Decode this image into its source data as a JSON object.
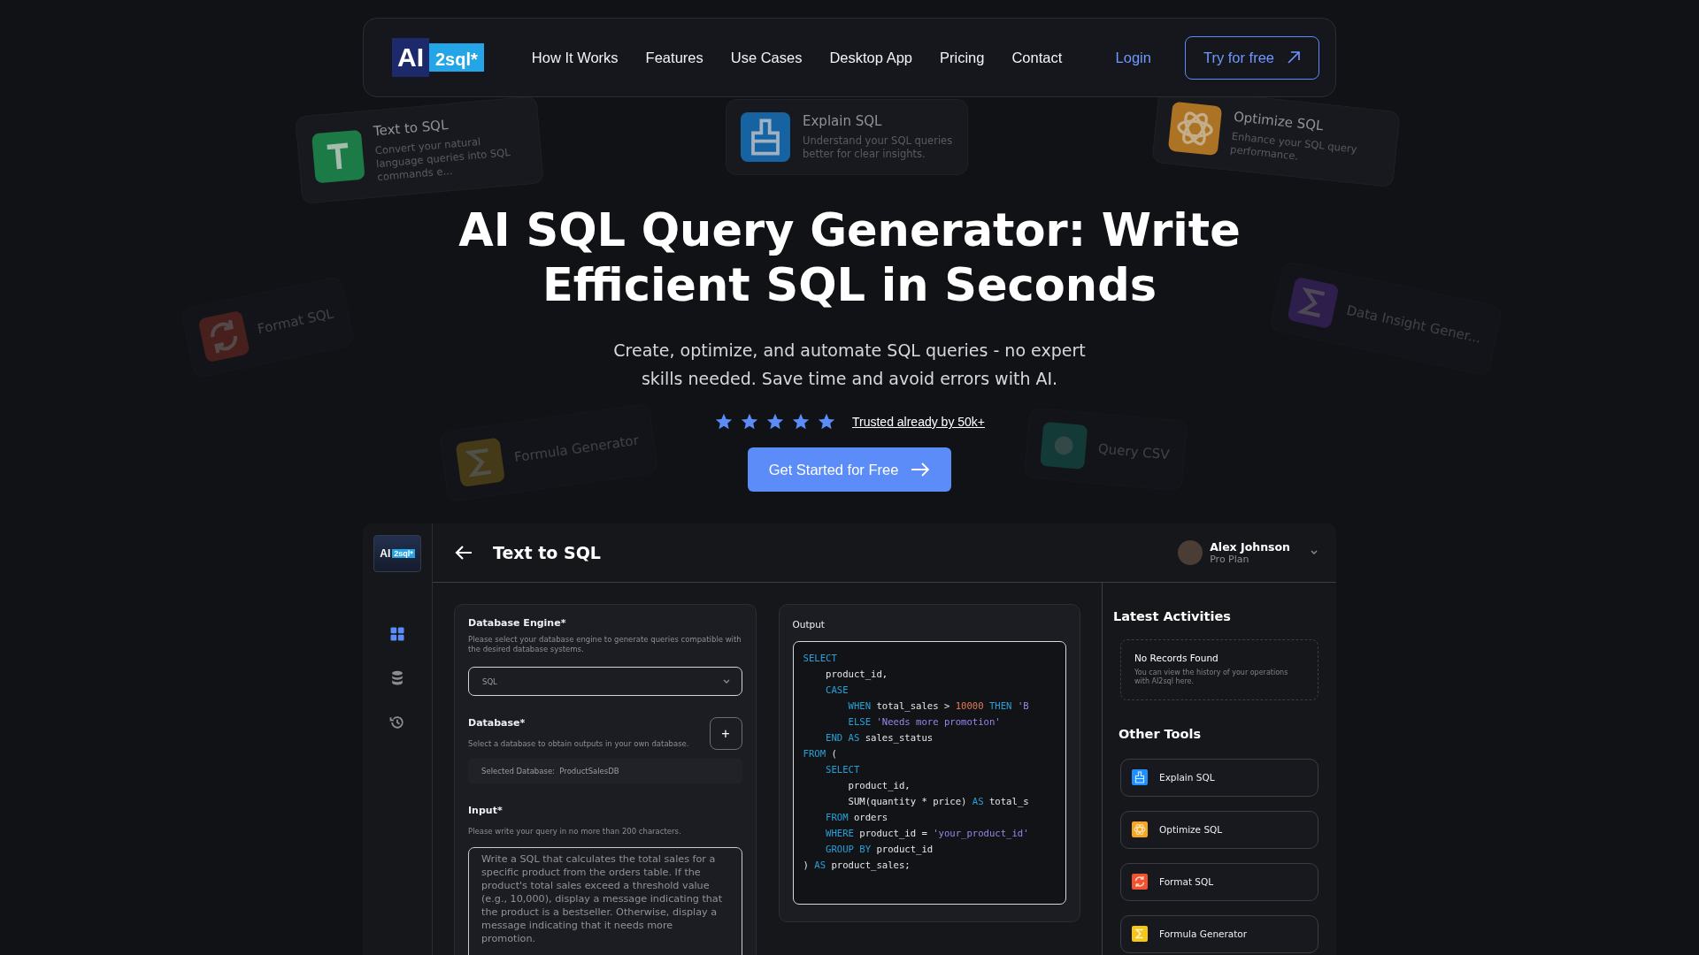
{
  "nav": {
    "logo": {
      "left": "AI",
      "right": "2sql*"
    },
    "links": [
      "How It Works",
      "Features",
      "Use Cases",
      "Desktop App",
      "Pricing",
      "Contact"
    ],
    "login": "Login",
    "cta": "Try for free"
  },
  "floating_cards": [
    {
      "title": "Text to SQL",
      "description": "Convert your natural language queries into SQL commands e...",
      "kind": "text"
    },
    {
      "title": "Explain SQL",
      "description": "Understand your SQL queries better for clear insights.",
      "kind": "brush"
    },
    {
      "title": "Optimize SQL",
      "description": "Enhance your SQL query performance.",
      "kind": "atom"
    },
    {
      "title": "Format SQL",
      "kind": "cycle"
    },
    {
      "title": "Formula Generator",
      "kind": "formula"
    },
    {
      "title": "Query CSV",
      "kind": "csv"
    },
    {
      "title": "Data Insight Gener...",
      "kind": "insight"
    }
  ],
  "hero": {
    "title": "AI SQL Query Generator: Write Efficient SQL in Seconds",
    "subtitle": "Create, optimize, and automate SQL queries - no expert skills needed. Save time and avoid errors with AI.",
    "rating": {
      "stars": 5,
      "label": "Trusted already by 50k+"
    },
    "button": "Get Started for Free"
  },
  "app": {
    "logo": {
      "left": "AI",
      "right": "2sql*"
    },
    "sidebar": [
      {
        "kind": "grid",
        "selected": true
      },
      {
        "kind": "database",
        "selected": false
      },
      {
        "kind": "history",
        "selected": false
      }
    ],
    "header": {
      "title": "Text to SQL",
      "user": {
        "name": "Alex Johnson",
        "plan": "Pro Plan"
      }
    },
    "form": {
      "engine": {
        "label": "Database Engine*",
        "description": "Please select your database engine to generate queries compatible with the desired database systems.",
        "value": "SQL"
      },
      "database": {
        "label": "Database*",
        "description": "Select a database to obtain outputs in your own database.",
        "add": "+",
        "selected": "Selected Database:  ProductSalesDB"
      },
      "input": {
        "label": "Input*",
        "description": "Please write your query in no more than 200 characters.",
        "value": "Write a SQL that calculates the total sales for a specific product from the orders table. If the product's total sales exceed a threshold value (e.g., 10,000), display a message indicating that the product is a bestseller. Otherwise, display a message indicating that it needs more promotion."
      }
    },
    "output": {
      "label": "Output",
      "code": [
        [
          {
            "kind": "kw",
            "text": "SELECT"
          }
        ],
        [
          {
            "kind": "plain",
            "text": "    product_id,"
          }
        ],
        [
          {
            "kind": "kw",
            "text": "    CASE"
          }
        ],
        [
          {
            "kind": "kw",
            "text": "        WHEN"
          },
          {
            "kind": "plain",
            "text": " total_sales > "
          },
          {
            "kind": "num",
            "text": "10000"
          },
          {
            "kind": "kw",
            "text": " THEN"
          },
          {
            "kind": "str",
            "text": " 'B"
          }
        ],
        [
          {
            "kind": "kw",
            "text": "        ELSE"
          },
          {
            "kind": "str",
            "text": " 'Needs more promotion'"
          }
        ],
        [
          {
            "kind": "kw",
            "text": "    END AS"
          },
          {
            "kind": "plain",
            "text": " sales_status"
          }
        ],
        [
          {
            "kind": "kw",
            "text": "FROM"
          },
          {
            "kind": "plain",
            "text": " ("
          }
        ],
        [
          {
            "kind": "kw",
            "text": "    SELECT"
          }
        ],
        [
          {
            "kind": "plain",
            "text": "        product_id,"
          }
        ],
        [
          {
            "kind": "plain",
            "text": "        SUM(quantity * price) "
          },
          {
            "kind": "kw",
            "text": "AS"
          },
          {
            "kind": "plain",
            "text": " total_s"
          }
        ],
        [
          {
            "kind": "kw",
            "text": "    FROM"
          },
          {
            "kind": "plain",
            "text": " orders"
          }
        ],
        [
          {
            "kind": "kw",
            "text": "    WHERE"
          },
          {
            "kind": "plain",
            "text": " product_id = "
          },
          {
            "kind": "str",
            "text": "'your_product_id'"
          }
        ],
        [
          {
            "kind": "kw",
            "text": "    GROUP BY"
          },
          {
            "kind": "plain",
            "text": " product_id"
          }
        ],
        [
          {
            "kind": "plain",
            "text": ") "
          },
          {
            "kind": "kw",
            "text": "AS"
          },
          {
            "kind": "plain",
            "text": " product_sales;"
          }
        ]
      ]
    },
    "activities": {
      "title": "Latest Activities",
      "empty_title": "No Records Found",
      "empty_text": "You can view the history of your operations with AI2sql here."
    },
    "tools": {
      "title": "Other Tools",
      "items": [
        {
          "label": "Explain SQL",
          "color": "#1e90ff",
          "kind": "brush"
        },
        {
          "label": "Optimize SQL",
          "color": "#f5a623",
          "kind": "atom"
        },
        {
          "label": "Format SQL",
          "color": "#f0532d",
          "kind": "cycle"
        },
        {
          "label": "Formula Generator",
          "color": "#f5c518",
          "kind": "sigma"
        }
      ]
    }
  }
}
